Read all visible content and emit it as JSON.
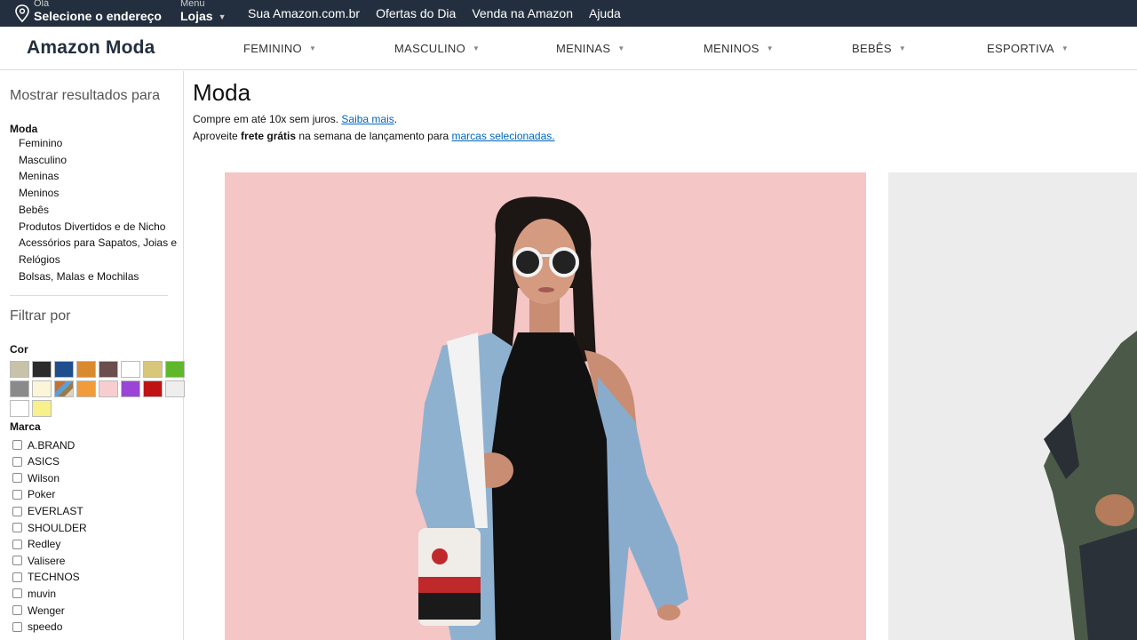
{
  "topbar": {
    "location_small": "Olá",
    "location_big": "Selecione o endereço",
    "menu_small": "Menu",
    "menu_big": "Lojas",
    "links": [
      "Sua Amazon.com.br",
      "Ofertas do Dia",
      "Venda na Amazon",
      "Ajuda"
    ]
  },
  "subnav": {
    "brand": "Amazon Moda",
    "categories": [
      "FEMININO",
      "MASCULINO",
      "MENINAS",
      "MENINOS",
      "BEBÊS",
      "ESPORTIVA"
    ]
  },
  "sidebar": {
    "show_results": "Mostrar resultados para",
    "moda": "Moda",
    "items": [
      "Feminino",
      "Masculino",
      "Meninas",
      "Meninos",
      "Bebês",
      "Produtos Divertidos e de Nicho",
      "Acessórios para Sapatos, Joias e",
      "Relógios",
      "Bolsas, Malas e Mochilas"
    ],
    "filter_by": "Filtrar por",
    "color_label": "Cor",
    "colors": [
      "#c8c2a8",
      "#2b2b2b",
      "#1e4f8c",
      "#d98a2f",
      "#6b4e4e",
      "#ffffff",
      "#d8c67a",
      "#5fb82a",
      "#8a8a8a",
      "#fbf6d8",
      "multi",
      "#f29b3b",
      "#f8cdd0",
      "#9a45d6",
      "#c01414",
      "#eeeeee",
      "#ffffff",
      "#f8f08a"
    ],
    "brand_label": "Marca",
    "brands": [
      "A.BRAND",
      "ASICS",
      "Wilson",
      "Poker",
      "EVERLAST",
      "SHOULDER",
      "Redley",
      "Valisere",
      "TECHNOS",
      "muvin",
      "Wenger",
      "speedo"
    ]
  },
  "main": {
    "title": "Moda",
    "promo1_text": "Compre em até 10x sem juros.",
    "promo1_link": "Saiba mais",
    "promo1_end": ".",
    "promo2_pre": "Aproveite ",
    "promo2_bold": "frete grátis",
    "promo2_mid": " na semana de lançamento para ",
    "promo2_link": "marcas selecionadas."
  }
}
